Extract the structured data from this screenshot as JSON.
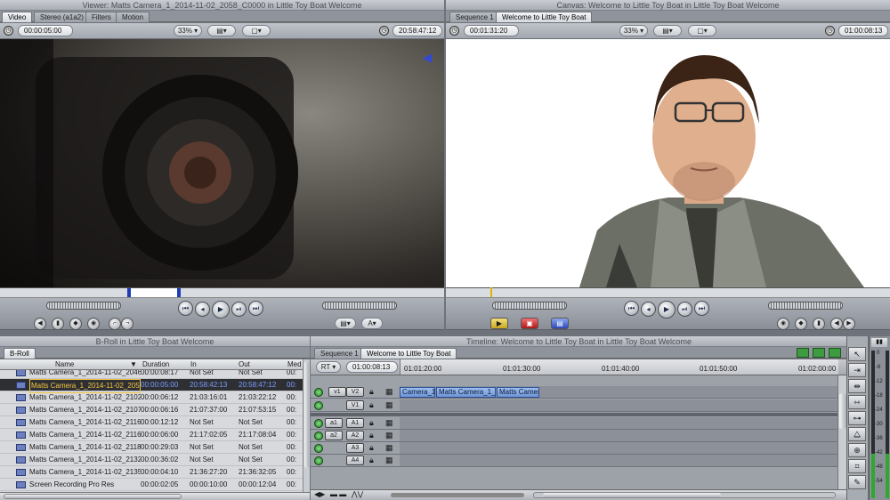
{
  "viewer": {
    "title": "Viewer: Matts Camera_1_2014-11-02_2058_C0000 in Little Toy Boat Welcome",
    "tabs": [
      "Video",
      "Stereo (a1a2)",
      "Filters",
      "Motion"
    ],
    "duration": "00:00:05:00",
    "zoom": "33%",
    "timecode": "20:58:47:12"
  },
  "canvas": {
    "title": "Canvas: Welcome to Little Toy Boat in Little Toy Boat Welcome",
    "tabs": [
      "Sequence 1",
      "Welcome to Little Toy Boat"
    ],
    "duration": "00:01:31:20",
    "zoom": "33%",
    "timecode": "01:00:08:13"
  },
  "browser": {
    "title": "B-Roll in Little Toy Boat Welcome",
    "tab": "B-Roll",
    "columns": [
      "Name",
      "Duration",
      "In",
      "Out",
      "Med"
    ],
    "rows": [
      {
        "name": "Matts Camera_1_2014-11-02_2046",
        "duration": "00:00:08:17",
        "in": "Not Set",
        "out": "Not Set",
        "med": "00:"
      },
      {
        "name": "Matts Camera_1_2014-11-02_2058",
        "duration": "00:00:05:00",
        "in": "20:58:42:13",
        "out": "20:58:47:12",
        "med": "00:"
      },
      {
        "name": "Matts Camera_1_2014-11-02_2102",
        "duration": "00:00:06:12",
        "in": "21:03:16:01",
        "out": "21:03:22:12",
        "med": "00:"
      },
      {
        "name": "Matts Camera_1_2014-11-02_2107",
        "duration": "00:00:06:16",
        "in": "21:07:37:00",
        "out": "21:07:53:15",
        "med": "00:"
      },
      {
        "name": "Matts Camera_1_2014-11-02_2116",
        "duration": "00:00:12:12",
        "in": "Not Set",
        "out": "Not Set",
        "med": "00:"
      },
      {
        "name": "Matts Camera_1_2014-11-02_2116",
        "duration": "00:00:06:00",
        "in": "21:17:02:05",
        "out": "21:17:08:04",
        "med": "00:"
      },
      {
        "name": "Matts Camera_1_2014-11-02_2118",
        "duration": "00:00:29:03",
        "in": "Not Set",
        "out": "Not Set",
        "med": "00:"
      },
      {
        "name": "Matts Camera_1_2014-11-02_2132",
        "duration": "00:00:36:02",
        "in": "Not Set",
        "out": "Not Set",
        "med": "00:"
      },
      {
        "name": "Matts Camera_1_2014-11-02_2135",
        "duration": "00:00:04:10",
        "in": "21:36:27:20",
        "out": "21:36:32:05",
        "med": "00:"
      },
      {
        "name": "Screen Recording Pro Res",
        "duration": "00:00:02:05",
        "in": "00:00:10:00",
        "out": "00:00:12:04",
        "med": "00:"
      }
    ]
  },
  "timeline": {
    "title": "Timeline: Welcome to Little Toy Boat in Little Toy Boat Welcome",
    "tabs": [
      "Sequence 1",
      "Welcome to Little Toy Boat"
    ],
    "rt": "RT",
    "timecode": "01:00:08:13",
    "ruler": [
      "01:01:20:00",
      "01:01:30:00",
      "01:01:40:00",
      "01:01:50:00",
      "01:02:00:00"
    ],
    "video_tracks": [
      {
        "src": "v1",
        "dest": "V2",
        "clips": [
          "Camera_1_2",
          "Matts Camera_1_2",
          "Matts Camer"
        ]
      },
      {
        "src": "",
        "dest": "V1",
        "clips": []
      }
    ],
    "audio_tracks": [
      {
        "src": "a1",
        "dest": "A1"
      },
      {
        "src": "a2",
        "dest": "A2"
      },
      {
        "src": "",
        "dest": "A3"
      },
      {
        "src": "",
        "dest": "A4"
      }
    ]
  },
  "meters": [
    "0",
    "-6",
    "-12",
    "-18",
    "-24",
    "-30",
    "-36",
    "-42",
    "-48",
    "-54"
  ],
  "icons": {
    "audio-meter-icon": "meter",
    "tool-select": "arrow",
    "tool-track": "track-select",
    "tool-edit": "roll",
    "tool-razor": "razor",
    "tool-slip": "slip",
    "tool-zoom": "magnifier",
    "tool-crop": "crop",
    "tool-pen": "pen"
  }
}
